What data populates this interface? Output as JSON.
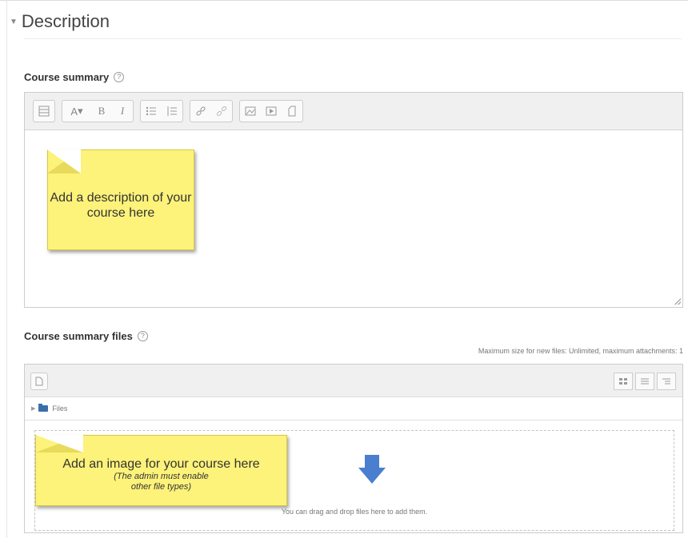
{
  "section": {
    "title": "Description"
  },
  "course_summary": {
    "label": "Course summary",
    "help_icon": "?",
    "toolbar_icons": [
      "toolbar-toggle-icon",
      "font-style-icon",
      "bold-icon",
      "italic-icon",
      "unordered-list-icon",
      "ordered-list-icon",
      "link-icon",
      "unlink-icon",
      "image-icon",
      "media-icon",
      "manage-files-icon"
    ],
    "bold_label": "B",
    "italic_label": "I",
    "font_label": "A",
    "note": "Add a description of your course here"
  },
  "summary_files": {
    "label": "Course summary files",
    "help_icon": "?",
    "max_size_text": "Maximum size for new files: Unlimited, maximum attachments: 1",
    "path_label": "Files",
    "drop_text": "You can drag and drop files here to add them.",
    "note_title": "Add an image for your course here",
    "note_sub_1": "(The admin must enable",
    "note_sub_2": "other file types)"
  },
  "colors": {
    "note_yellow": "#fdf27a",
    "arrow_blue": "#4a7fd0",
    "folder_blue": "#3b6ea8"
  }
}
